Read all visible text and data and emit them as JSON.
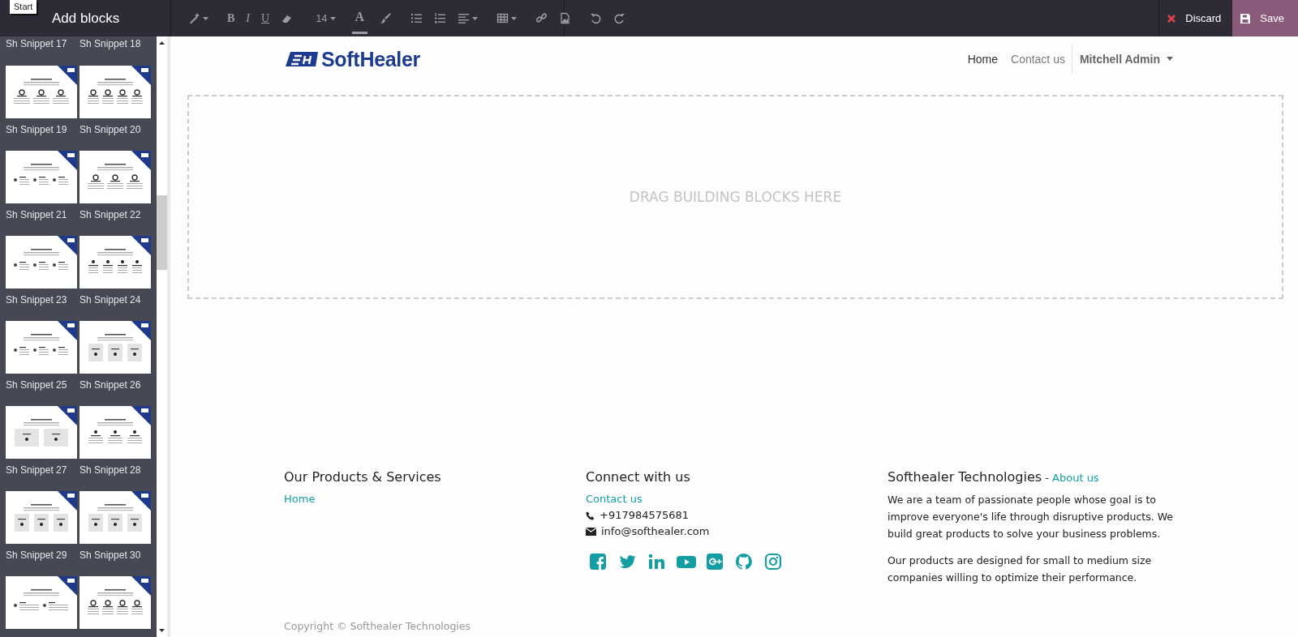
{
  "tooltip": "Start",
  "sidebar": {
    "title": "Add blocks",
    "snippets": [
      {
        "kind": "label",
        "label": "Sh Snippet 17"
      },
      {
        "kind": "label",
        "label": "Sh Snippet 18"
      },
      {
        "kind": "snippet",
        "label": "Sh Snippet 19"
      },
      {
        "kind": "snippet",
        "label": "Sh Snippet 20"
      },
      {
        "kind": "snippet",
        "label": "Sh Snippet 21"
      },
      {
        "kind": "snippet",
        "label": "Sh Snippet 22"
      },
      {
        "kind": "snippet",
        "label": "Sh Snippet 23"
      },
      {
        "kind": "snippet",
        "label": "Sh Snippet 24"
      },
      {
        "kind": "snippet",
        "label": "Sh Snippet 25"
      },
      {
        "kind": "snippet",
        "label": "Sh Snippet 26"
      },
      {
        "kind": "snippet",
        "label": "Sh Snippet 27"
      },
      {
        "kind": "snippet",
        "label": "Sh Snippet 28"
      },
      {
        "kind": "snippet",
        "label": "Sh Snippet 29"
      },
      {
        "kind": "snippet",
        "label": "Sh Snippet 30"
      },
      {
        "kind": "thumb"
      },
      {
        "kind": "thumb"
      }
    ]
  },
  "toolbar": [
    {
      "kind": "wand",
      "caret": true
    },
    {
      "kind": "bold",
      "text": "B",
      "caret": false
    },
    {
      "kind": "italic",
      "text": "I",
      "caret": false
    },
    {
      "kind": "underline",
      "text": "U",
      "caret": false
    },
    {
      "kind": "eraser",
      "caret": false
    },
    {
      "kind": "size",
      "text": "14",
      "caret": true
    },
    {
      "kind": "color",
      "text": "A",
      "caret": false
    },
    {
      "kind": "brush",
      "caret": false
    },
    {
      "kind": "ul",
      "caret": false
    },
    {
      "kind": "ol",
      "caret": false
    },
    {
      "kind": "align",
      "caret": true
    },
    {
      "kind": "table",
      "caret": true
    },
    {
      "kind": "link",
      "caret": false
    },
    {
      "kind": "image",
      "caret": false
    },
    {
      "kind": "undo",
      "caret": false
    },
    {
      "kind": "redo",
      "caret": false
    }
  ],
  "actions": [
    {
      "kind": "discard",
      "label": "Discard"
    },
    {
      "kind": "save",
      "label": "Save"
    }
  ],
  "header": {
    "logo": "SoftHealer",
    "nav": [
      {
        "label": "Home",
        "selected": true
      },
      {
        "label": "Contact us",
        "selected": false
      }
    ],
    "user": "Mitchell Admin"
  },
  "dropzone": "DRAG BUILDING BLOCKS HERE",
  "footer": {
    "columns": [
      {
        "title": "Our Products & Services",
        "links": [
          "Home"
        ]
      },
      {
        "title": "Connect with us",
        "links": [
          "Contact us"
        ],
        "contacts": [
          {
            "kind": "phone",
            "text": "+917984575681"
          },
          {
            "kind": "mail",
            "text": "info@softhealer.com"
          }
        ],
        "social": [
          {
            "kind": "facebook"
          },
          {
            "kind": "twitter"
          },
          {
            "kind": "linkedin"
          },
          {
            "kind": "youtube"
          },
          {
            "kind": "gplus"
          },
          {
            "kind": "github"
          },
          {
            "kind": "instagram"
          }
        ]
      },
      {
        "title": "Softhealer Technologies",
        "title_link_sep": " - ",
        "title_link": "About us",
        "paragraphs": [
          "We are a team of passionate people whose goal is to improve everyone's life through disruptive products. We build great products to solve your business problems.",
          "Our products are designed for small to medium size companies willing to optimize their performance."
        ]
      }
    ],
    "copyright": "Copyright © Softhealer Technologies"
  }
}
